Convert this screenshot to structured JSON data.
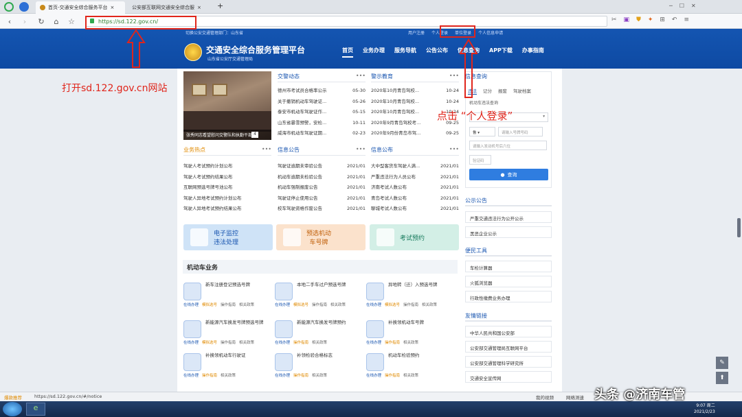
{
  "browser": {
    "tabs": [
      {
        "label": "首页-交通安全综合服务平台",
        "active": true
      },
      {
        "label": "公安部互联网交通安全综合服",
        "active": false
      }
    ],
    "new_tab": "+",
    "url": "https://sd.122.gov.cn/",
    "status_text": "爆款推荐",
    "status_url": "https://sd.122.gov.cn/#/notice",
    "status_right": [
      "我的视频",
      "网络测速"
    ],
    "clock": "9:07 周二",
    "date": "2021/2/23"
  },
  "site": {
    "toplinks": [
      "切换公安交通管理部门：山东省",
      "用户注册",
      "个人登录",
      "单位登录",
      "个人信息申请"
    ],
    "title": "交通安全综合服务管理平台",
    "subtitle": "山东省公安厅交通管理局",
    "nav": [
      "首页",
      "业务办理",
      "服务导航",
      "公告公布",
      "信息查询",
      "APP下载",
      "办事指南"
    ],
    "photo_caption": "张秀同志看望慰问交警队和执勤干部",
    "photo_page": "4"
  },
  "news": {
    "jingwu": {
      "title": "交警动态",
      "more": "•••",
      "items": [
        {
          "text": "德州市考试员合格率公示",
          "date": "05-30"
        },
        {
          "text": "关于撤销机动车驾驶证...",
          "date": "05-26"
        },
        {
          "text": "泰安市机动车驾驶证作...",
          "date": "05-15"
        },
        {
          "text": "山东省暴雪预警，安检...",
          "date": "10-11"
        },
        {
          "text": "威海市机动车驾驶证期...",
          "date": "02-23"
        }
      ]
    },
    "jingshi": {
      "title": "警示教育",
      "more": "•••",
      "items": [
        {
          "text": "2020年10月青岛驾校...",
          "date": "10-24"
        },
        {
          "text": "2020年10月青岛驾校...",
          "date": "10-24"
        },
        {
          "text": "2020年10月青岛驾校...",
          "date": "10-24"
        },
        {
          "text": "2020年9月青岛驾校考...",
          "date": "09-25"
        },
        {
          "text": "2020年9月份青岛市驾...",
          "date": "09-25"
        }
      ]
    },
    "hotspot": {
      "title": "业务热点",
      "more": "•••",
      "items": [
        "驾驶人考试预约计划公布",
        "驾驶人考试预约结果公布",
        "互联网预选号牌号池公布",
        "驾驶人异地考试预约计划公布",
        "驾驶人异地考试预约结果公布"
      ]
    },
    "xinxi": {
      "title": "信息公告",
      "more": "•••",
      "items": [
        {
          "text": "驾驶证逾期未审验公告",
          "date": "2021/01"
        },
        {
          "text": "机动车逾期未检验公告",
          "date": "2021/01"
        },
        {
          "text": "机动车强制报废公告",
          "date": "2021/01"
        },
        {
          "text": "驾驶证停止使用公告",
          "date": "2021/01"
        },
        {
          "text": "校车驾驶资格作废公告",
          "date": "2021/01"
        }
      ]
    },
    "gongbu": {
      "title": "信息公布",
      "more": "•••",
      "items": [
        {
          "text": "大中型客货车驾驶人满...",
          "date": "2021/01"
        },
        {
          "text": "严重违法行为人员公布",
          "date": "2021/01"
        },
        {
          "text": "济南考试人数公布",
          "date": "2021/01"
        },
        {
          "text": "青岛考试人数公布",
          "date": "2021/01"
        },
        {
          "text": "聊城考试人数公布",
          "date": "2021/01"
        }
      ]
    }
  },
  "quick_buttons": [
    {
      "label": "电子监控\n违法处理",
      "bg": "#cfe3f7",
      "color": "#1a56b0"
    },
    {
      "label": "预选机动\n车号牌",
      "bg": "#fbe2cc",
      "color": "#c0600a"
    },
    {
      "label": "考试预约",
      "bg": "#d3efe6",
      "color": "#167a5c"
    }
  ],
  "vehicle_section": {
    "title": "机动车业务",
    "items": [
      {
        "title": "新车注册登记预选号牌",
        "links": [
          "在线办理",
          "模拟选号",
          "操作指南",
          "相关政策"
        ]
      },
      {
        "title": "本地二手车过户预选号牌",
        "links": [
          "在线办理",
          "模拟选号",
          "操作指南",
          "相关政策"
        ]
      },
      {
        "title": "异地转（迁）入预选号牌",
        "links": [
          "在线办理",
          "模拟选号",
          "操作指南",
          "相关政策"
        ]
      },
      {
        "title": "新能源汽车换发号牌预选号牌",
        "links": [
          "在线办理",
          "模拟选号",
          "操作指南",
          "相关政策"
        ]
      },
      {
        "title": "新能源汽车换发号牌预约",
        "links": [
          "在线办理",
          "操作指南",
          "相关政策"
        ]
      },
      {
        "title": "补换领机动车号牌",
        "links": [
          "在线办理",
          "操作指南",
          "相关政策"
        ]
      },
      {
        "title": "补换领机动车行驶证",
        "links": [
          "在线办理",
          "操作指南",
          "相关政策"
        ]
      },
      {
        "title": "补领检验合格标志",
        "links": [
          "在线办理",
          "操作指南",
          "相关政策"
        ]
      },
      {
        "title": "机动车检验预约",
        "links": [
          "在线办理",
          "操作指南",
          "相关政策"
        ]
      }
    ]
  },
  "query": {
    "title": "信息查询",
    "tabs": [
      "违法",
      "记分",
      "报废",
      "驾驶档案"
    ],
    "subtitle": "机动车违法查询",
    "plate_type_placeholder": "",
    "province": "鲁",
    "plate_placeholder": "请输入号牌号码",
    "vin_placeholder": "请输入发动机号后六位",
    "code_placeholder": "验证码",
    "button": "查询"
  },
  "side": {
    "notice_title": "公示公告",
    "notice_items": [
      "严重交通违法行为公开公示",
      "黑恶企业公示"
    ],
    "tools_title": "便民工具",
    "tools_items": [
      "车检计算器",
      "火狐浏览器",
      "行政性缴费业务办理"
    ],
    "links_title": "友情链接",
    "links_items": [
      "中华人民共和国公安部",
      "公安部交通管理局互联网平台",
      "公安部交通管理科学研究所",
      "交通安全宣传网"
    ]
  },
  "annotations": {
    "step1": "打开sd.122.gov.cn网站",
    "step2": "点击 “个人登录”"
  },
  "watermark": "头条 @济南车管"
}
